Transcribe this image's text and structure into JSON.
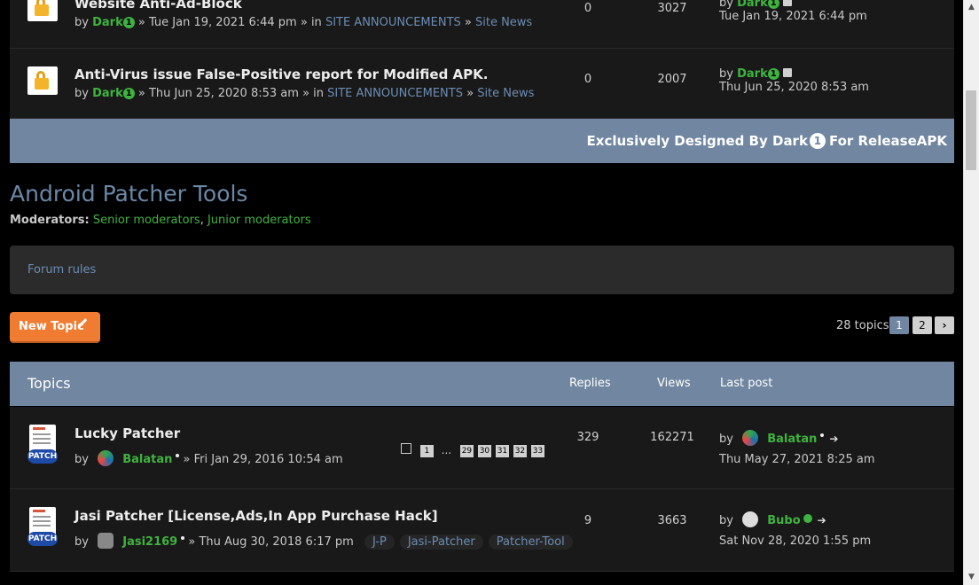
{
  "announcements": [
    {
      "title": "Website Anti-Ad-Block",
      "author": "Dark",
      "author_badge": "1",
      "date": "Tue Jan 19, 2021 6:44 pm",
      "in_label": "» in",
      "forum": "SITE ANNOUNCEMENTS",
      "subforum": "Site News",
      "replies": "0",
      "views": "3027",
      "last_by": "by",
      "last_author": "Dark",
      "last_date": "Tue Jan 19, 2021 6:44 pm"
    },
    {
      "title": "Anti-Virus issue False-Positive report for Modified APK.",
      "author": "Dark",
      "author_badge": "1",
      "date": "Thu Jun 25, 2020 8:53 am",
      "in_label": "» in",
      "forum": "SITE ANNOUNCEMENTS",
      "subforum": "Site News",
      "replies": "0",
      "views": "2007",
      "last_by": "by",
      "last_author": "Dark",
      "last_date": "Thu Jun 25, 2020 8:53 am"
    }
  ],
  "banner": {
    "prefix": "Exclusively Designed By Dark",
    "badge": "1",
    "suffix": "For ReleaseAPK"
  },
  "forum": {
    "title": "Android Patcher Tools",
    "moderators_label": "Moderators:",
    "mod_senior": "Senior moderators",
    "mod_junior": "Junior moderators",
    "rules_label": "Forum rules"
  },
  "actions": {
    "new_topic": "New Topic",
    "topic_count": "28 topics",
    "pages": [
      "1",
      "2"
    ]
  },
  "table_head": {
    "topics": "Topics",
    "replies": "Replies",
    "views": "Views",
    "last_post": "Last post"
  },
  "topics": [
    {
      "title": "Lucky Patcher",
      "by": "by",
      "author": "Balatan",
      "date": "» Fri Jan 29, 2016 10:54 am",
      "pages": [
        "1",
        "...",
        "29",
        "30",
        "31",
        "32",
        "33"
      ],
      "replies": "329",
      "views": "162271",
      "last_by": "by",
      "last_author": "Balatan",
      "last_date": "Thu May 27, 2021 8:25 am"
    },
    {
      "title": "Jasi Patcher [License,Ads,In App Purchase Hack]",
      "by": "by",
      "author": "Jasi2169",
      "date": "» Thu Aug 30, 2018 6:17 pm",
      "tags": [
        "J-P",
        "Jasi-Patcher",
        "Patcher-Tool"
      ],
      "replies": "9",
      "views": "3663",
      "last_by": "by",
      "last_author": "Bubo",
      "last_date": "Sat Nov 28, 2020 1:55 pm"
    }
  ],
  "colors": {
    "header_bar": "#7186a1",
    "username": "#3fb33f",
    "link": "#6b8db3",
    "accent": "#f07c32"
  }
}
